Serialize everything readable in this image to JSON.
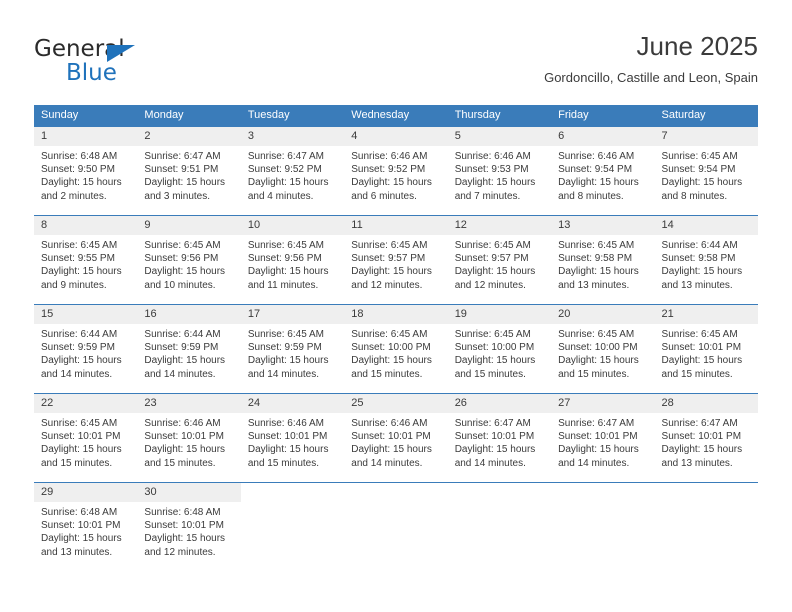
{
  "brand": {
    "name_part1": "General",
    "name_part2": "Blue",
    "accent_color": "#1f72bb",
    "triangle_icon": "brand-triangle-icon"
  },
  "header": {
    "title": "June 2025",
    "subtitle": "Gordoncillo, Castille and Leon, Spain"
  },
  "calendar": {
    "header_bg": "#3a7cba",
    "daynum_bg": "#efefef",
    "weekdays": [
      "Sunday",
      "Monday",
      "Tuesday",
      "Wednesday",
      "Thursday",
      "Friday",
      "Saturday"
    ],
    "weeks": [
      [
        {
          "day": "1",
          "sunrise": "Sunrise: 6:48 AM",
          "sunset": "Sunset: 9:50 PM",
          "daylight": "Daylight: 15 hours and 2 minutes."
        },
        {
          "day": "2",
          "sunrise": "Sunrise: 6:47 AM",
          "sunset": "Sunset: 9:51 PM",
          "daylight": "Daylight: 15 hours and 3 minutes."
        },
        {
          "day": "3",
          "sunrise": "Sunrise: 6:47 AM",
          "sunset": "Sunset: 9:52 PM",
          "daylight": "Daylight: 15 hours and 4 minutes."
        },
        {
          "day": "4",
          "sunrise": "Sunrise: 6:46 AM",
          "sunset": "Sunset: 9:52 PM",
          "daylight": "Daylight: 15 hours and 6 minutes."
        },
        {
          "day": "5",
          "sunrise": "Sunrise: 6:46 AM",
          "sunset": "Sunset: 9:53 PM",
          "daylight": "Daylight: 15 hours and 7 minutes."
        },
        {
          "day": "6",
          "sunrise": "Sunrise: 6:46 AM",
          "sunset": "Sunset: 9:54 PM",
          "daylight": "Daylight: 15 hours and 8 minutes."
        },
        {
          "day": "7",
          "sunrise": "Sunrise: 6:45 AM",
          "sunset": "Sunset: 9:54 PM",
          "daylight": "Daylight: 15 hours and 8 minutes."
        }
      ],
      [
        {
          "day": "8",
          "sunrise": "Sunrise: 6:45 AM",
          "sunset": "Sunset: 9:55 PM",
          "daylight": "Daylight: 15 hours and 9 minutes."
        },
        {
          "day": "9",
          "sunrise": "Sunrise: 6:45 AM",
          "sunset": "Sunset: 9:56 PM",
          "daylight": "Daylight: 15 hours and 10 minutes."
        },
        {
          "day": "10",
          "sunrise": "Sunrise: 6:45 AM",
          "sunset": "Sunset: 9:56 PM",
          "daylight": "Daylight: 15 hours and 11 minutes."
        },
        {
          "day": "11",
          "sunrise": "Sunrise: 6:45 AM",
          "sunset": "Sunset: 9:57 PM",
          "daylight": "Daylight: 15 hours and 12 minutes."
        },
        {
          "day": "12",
          "sunrise": "Sunrise: 6:45 AM",
          "sunset": "Sunset: 9:57 PM",
          "daylight": "Daylight: 15 hours and 12 minutes."
        },
        {
          "day": "13",
          "sunrise": "Sunrise: 6:45 AM",
          "sunset": "Sunset: 9:58 PM",
          "daylight": "Daylight: 15 hours and 13 minutes."
        },
        {
          "day": "14",
          "sunrise": "Sunrise: 6:44 AM",
          "sunset": "Sunset: 9:58 PM",
          "daylight": "Daylight: 15 hours and 13 minutes."
        }
      ],
      [
        {
          "day": "15",
          "sunrise": "Sunrise: 6:44 AM",
          "sunset": "Sunset: 9:59 PM",
          "daylight": "Daylight: 15 hours and 14 minutes."
        },
        {
          "day": "16",
          "sunrise": "Sunrise: 6:44 AM",
          "sunset": "Sunset: 9:59 PM",
          "daylight": "Daylight: 15 hours and 14 minutes."
        },
        {
          "day": "17",
          "sunrise": "Sunrise: 6:45 AM",
          "sunset": "Sunset: 9:59 PM",
          "daylight": "Daylight: 15 hours and 14 minutes."
        },
        {
          "day": "18",
          "sunrise": "Sunrise: 6:45 AM",
          "sunset": "Sunset: 10:00 PM",
          "daylight": "Daylight: 15 hours and 15 minutes."
        },
        {
          "day": "19",
          "sunrise": "Sunrise: 6:45 AM",
          "sunset": "Sunset: 10:00 PM",
          "daylight": "Daylight: 15 hours and 15 minutes."
        },
        {
          "day": "20",
          "sunrise": "Sunrise: 6:45 AM",
          "sunset": "Sunset: 10:00 PM",
          "daylight": "Daylight: 15 hours and 15 minutes."
        },
        {
          "day": "21",
          "sunrise": "Sunrise: 6:45 AM",
          "sunset": "Sunset: 10:01 PM",
          "daylight": "Daylight: 15 hours and 15 minutes."
        }
      ],
      [
        {
          "day": "22",
          "sunrise": "Sunrise: 6:45 AM",
          "sunset": "Sunset: 10:01 PM",
          "daylight": "Daylight: 15 hours and 15 minutes."
        },
        {
          "day": "23",
          "sunrise": "Sunrise: 6:46 AM",
          "sunset": "Sunset: 10:01 PM",
          "daylight": "Daylight: 15 hours and 15 minutes."
        },
        {
          "day": "24",
          "sunrise": "Sunrise: 6:46 AM",
          "sunset": "Sunset: 10:01 PM",
          "daylight": "Daylight: 15 hours and 15 minutes."
        },
        {
          "day": "25",
          "sunrise": "Sunrise: 6:46 AM",
          "sunset": "Sunset: 10:01 PM",
          "daylight": "Daylight: 15 hours and 14 minutes."
        },
        {
          "day": "26",
          "sunrise": "Sunrise: 6:47 AM",
          "sunset": "Sunset: 10:01 PM",
          "daylight": "Daylight: 15 hours and 14 minutes."
        },
        {
          "day": "27",
          "sunrise": "Sunrise: 6:47 AM",
          "sunset": "Sunset: 10:01 PM",
          "daylight": "Daylight: 15 hours and 14 minutes."
        },
        {
          "day": "28",
          "sunrise": "Sunrise: 6:47 AM",
          "sunset": "Sunset: 10:01 PM",
          "daylight": "Daylight: 15 hours and 13 minutes."
        }
      ],
      [
        {
          "day": "29",
          "sunrise": "Sunrise: 6:48 AM",
          "sunset": "Sunset: 10:01 PM",
          "daylight": "Daylight: 15 hours and 13 minutes."
        },
        {
          "day": "30",
          "sunrise": "Sunrise: 6:48 AM",
          "sunset": "Sunset: 10:01 PM",
          "daylight": "Daylight: 15 hours and 12 minutes."
        },
        {
          "day": "",
          "sunrise": "",
          "sunset": "",
          "daylight": ""
        },
        {
          "day": "",
          "sunrise": "",
          "sunset": "",
          "daylight": ""
        },
        {
          "day": "",
          "sunrise": "",
          "sunset": "",
          "daylight": ""
        },
        {
          "day": "",
          "sunrise": "",
          "sunset": "",
          "daylight": ""
        },
        {
          "day": "",
          "sunrise": "",
          "sunset": "",
          "daylight": ""
        }
      ]
    ]
  }
}
